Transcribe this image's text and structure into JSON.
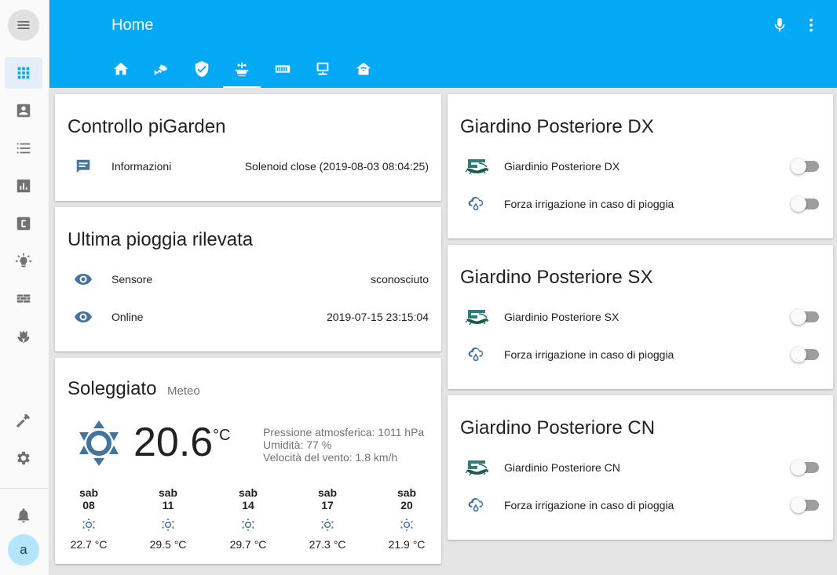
{
  "header": {
    "title": "Home",
    "tabs": [
      {
        "name": "home-icon"
      },
      {
        "name": "cctv-icon"
      },
      {
        "name": "shield-check-icon"
      },
      {
        "name": "fountain-icon",
        "active": true
      },
      {
        "name": "memory-icon"
      },
      {
        "name": "monitor-icon"
      },
      {
        "name": "home-wifi-icon"
      }
    ]
  },
  "sidebar": {
    "items": [
      "overview-icon",
      "account-box-icon",
      "list-icon",
      "chart-bar-icon",
      "alpha-c-box-icon",
      "lightbulb-icon",
      "wall-icon",
      "flower-tulip-icon"
    ],
    "bottom": [
      "hammer-icon",
      "settings-icon",
      "bell-icon"
    ],
    "avatar": "a"
  },
  "controllo": {
    "title": "Controllo piGarden",
    "rows": [
      {
        "name": "Informazioni",
        "value": "Solenoid close (2019-08-03 08:04:25)"
      }
    ]
  },
  "pioggia": {
    "title": "Ultima pioggia rilevata",
    "rows": [
      {
        "name": "Sensore",
        "value": "sconosciuto"
      },
      {
        "name": "Online",
        "value": "2019-07-15 23:15:04"
      }
    ]
  },
  "weather": {
    "condition": "Soleggiato",
    "name": "Meteo",
    "temperature": "20.6",
    "unit": "°C",
    "attributes": [
      "Pressione atmosferica: 1011 hPa",
      "Umidità: 77 %",
      "Velocità del vento: 1.8 km/h"
    ],
    "forecast": [
      {
        "day": "sab",
        "date": "08",
        "temp": "22.7 °C"
      },
      {
        "day": "sab",
        "date": "11",
        "temp": "29.5 °C"
      },
      {
        "day": "sab",
        "date": "14",
        "temp": "29.7 °C"
      },
      {
        "day": "sab",
        "date": "17",
        "temp": "27.3 °C"
      },
      {
        "day": "sab",
        "date": "20",
        "temp": "21.9 °C"
      }
    ]
  },
  "zones": [
    {
      "title": "Giardino Posteriore DX",
      "switch_label": "Giardinio Posteriore DX",
      "rain_label": "Forza irrigazione in caso di pioggia"
    },
    {
      "title": "Giardino Posteriore SX",
      "switch_label": "Giardinio Posteriore SX",
      "rain_label": "Forza irrigazione in caso di pioggia"
    },
    {
      "title": "Giardino Posteriore CN",
      "switch_label": "Giardinio Posteriore CN",
      "rain_label": "Forza irrigazione in caso di pioggia"
    }
  ],
  "colors": {
    "header": "#03a9f4",
    "icon": "#44739e",
    "sidebar_icon": "#727272"
  }
}
